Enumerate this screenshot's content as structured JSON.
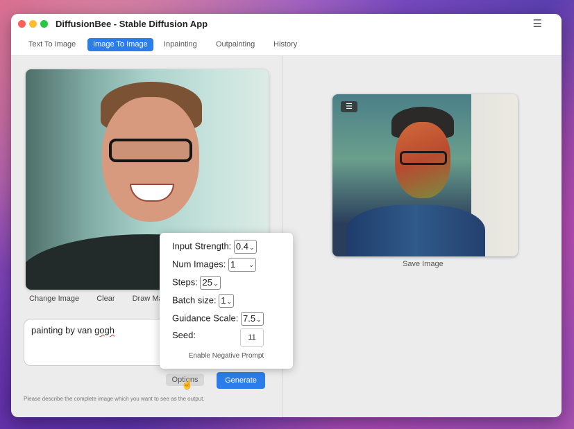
{
  "window": {
    "title": "DiffusionBee - Stable Diffusion App",
    "menu_icon": "hamburger-menu-icon"
  },
  "tabs": [
    {
      "label": "Text To Image",
      "active": false
    },
    {
      "label": "Image To Image",
      "active": true
    },
    {
      "label": "Inpainting",
      "active": false
    },
    {
      "label": "Outpainting",
      "active": false
    },
    {
      "label": "History",
      "active": false
    }
  ],
  "input_panel": {
    "actions": [
      "Change Image",
      "Clear",
      "Draw Ma"
    ],
    "prompt": {
      "text_before": "painting by van ",
      "text_misspelled": "gogh"
    },
    "options_label": "Options",
    "generate_label": "Generate",
    "hint": "Please describe the complete image which you want to see as the output."
  },
  "options": {
    "input_strength": {
      "label": "Input Strength:",
      "value": "0.4"
    },
    "num_images": {
      "label": "Num Images:",
      "value": "1"
    },
    "steps": {
      "label": "Steps:",
      "value": "25"
    },
    "batch_size": {
      "label": "Batch size:",
      "value": "1"
    },
    "guidance_scale": {
      "label": "Guidance Scale:",
      "value": "7.5"
    },
    "seed": {
      "label": "Seed:",
      "value": "11"
    },
    "negative_prompt_label": "Enable Negative Prompt"
  },
  "output_panel": {
    "save_label": "Save Image",
    "menu_icon": "hamburger-menu-icon"
  },
  "colors": {
    "accent": "#2b7de9",
    "window_bg": "#ececec"
  }
}
